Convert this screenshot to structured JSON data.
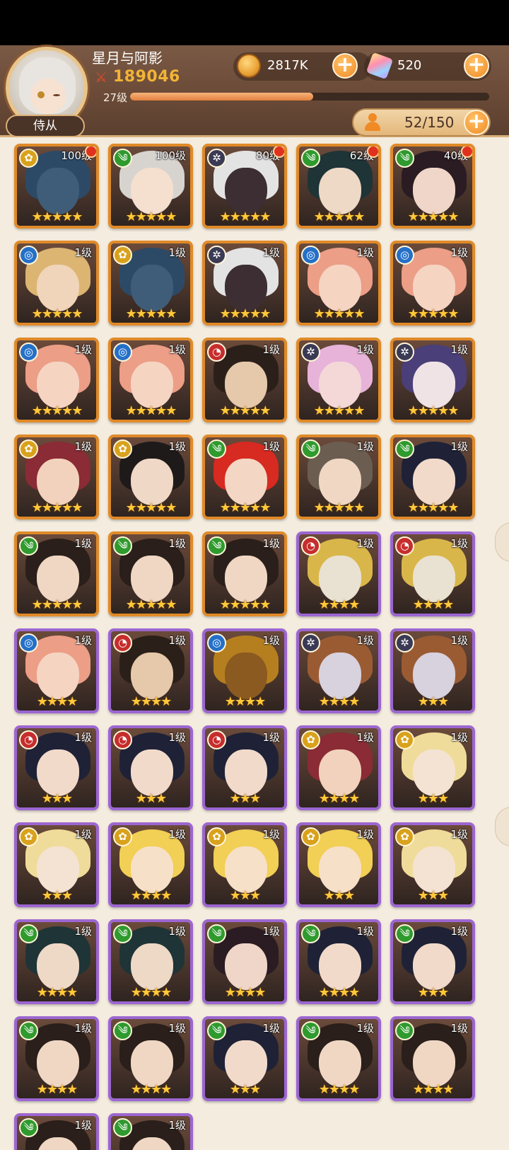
{
  "player": {
    "name": "星月与阿影",
    "power": "189046",
    "level": "27级",
    "xp_fraction": 0.51
  },
  "resources": {
    "coins": "2817K",
    "gems": "520"
  },
  "tab_label": "侍从",
  "roster_count": "52/150",
  "colors": {
    "gold_border": "#e08a28",
    "purple_border": "#9c66d1",
    "element_gold": "#d9a21c",
    "element_green": "#2f9a2e",
    "element_blue": "#2470c8",
    "element_red": "#c62d2d",
    "element_dark": "#3a3a55"
  },
  "heroes": [
    {
      "level": "100级",
      "element": "gold",
      "stars": "★★★★★",
      "frame": "gold",
      "alert": true,
      "hair": "#2c4a66",
      "skin": "#3f5d78"
    },
    {
      "level": "100级",
      "element": "green",
      "stars": "★★★★★",
      "frame": "gold",
      "alert": false,
      "hair": "#d7d4cf",
      "skin": "#f5dfcf"
    },
    {
      "level": "80级",
      "element": "dark",
      "stars": "★★★★★",
      "frame": "gold",
      "alert": true,
      "hair": "#e3e3e3",
      "skin": "#3c2e33"
    },
    {
      "level": "62级",
      "element": "green",
      "stars": "★★★★★",
      "frame": "gold",
      "alert": true,
      "hair": "#1f3437",
      "skin": "#eed8c6"
    },
    {
      "level": "40级",
      "element": "green",
      "stars": "★★★★★",
      "frame": "gold",
      "alert": true,
      "hair": "#2a1c22",
      "skin": "#f0d6c8"
    },
    {
      "level": "1级",
      "element": "blue",
      "stars": "★★★★★",
      "frame": "gold",
      "alert": false,
      "hair": "#dcb572",
      "skin": "#f0d5ba"
    },
    {
      "level": "1级",
      "element": "gold",
      "stars": "★★★★★",
      "frame": "gold",
      "alert": false,
      "hair": "#2c4a66",
      "skin": "#3f5d78"
    },
    {
      "level": "1级",
      "element": "dark",
      "stars": "★★★★★",
      "frame": "gold",
      "alert": false,
      "hair": "#e3e3e3",
      "skin": "#3c2e33"
    },
    {
      "level": "1级",
      "element": "blue",
      "stars": "★★★★★",
      "frame": "gold",
      "alert": false,
      "hair": "#ec9e86",
      "skin": "#f5d4c2"
    },
    {
      "level": "1级",
      "element": "blue",
      "stars": "★★★★★",
      "frame": "gold",
      "alert": false,
      "hair": "#ec9e86",
      "skin": "#f5d4c2"
    },
    {
      "level": "1级",
      "element": "blue",
      "stars": "★★★★★",
      "frame": "gold",
      "alert": false,
      "hair": "#ec9e86",
      "skin": "#f5d4c2"
    },
    {
      "level": "1级",
      "element": "blue",
      "stars": "★★★★★",
      "frame": "gold",
      "alert": false,
      "hair": "#ec9e86",
      "skin": "#f5d4c2"
    },
    {
      "level": "1级",
      "element": "red",
      "stars": "★★★★★",
      "frame": "gold",
      "alert": false,
      "hair": "#2b2019",
      "skin": "#e6c8aa"
    },
    {
      "level": "1级",
      "element": "dark",
      "stars": "★★★★★",
      "frame": "gold",
      "alert": false,
      "hair": "#e7b3d9",
      "skin": "#f4d8d8"
    },
    {
      "level": "1级",
      "element": "dark",
      "stars": "★★★★★",
      "frame": "gold",
      "alert": false,
      "hair": "#4a3f78",
      "skin": "#f0e3e6"
    },
    {
      "level": "1级",
      "element": "gold",
      "stars": "★★★★★",
      "frame": "gold",
      "alert": false,
      "hair": "#8a2b35",
      "skin": "#f2d2bc"
    },
    {
      "level": "1级",
      "element": "gold",
      "stars": "★★★★★",
      "frame": "gold",
      "alert": false,
      "hair": "#1f1a1a",
      "skin": "#f0d8c6"
    },
    {
      "level": "1级",
      "element": "green",
      "stars": "★★★★★",
      "frame": "gold",
      "alert": false,
      "hair": "#d72a21",
      "skin": "#f4d6c4"
    },
    {
      "level": "1级",
      "element": "green",
      "stars": "★★★★★",
      "frame": "gold",
      "alert": false,
      "hair": "#6b5d50",
      "skin": "#efd7c4"
    },
    {
      "level": "1级",
      "element": "green",
      "stars": "★★★★★",
      "frame": "gold",
      "alert": false,
      "hair": "#1f2236",
      "skin": "#f2dacb"
    },
    {
      "level": "1级",
      "element": "green",
      "stars": "★★★★★",
      "frame": "gold",
      "alert": false,
      "hair": "#2a1f1a",
      "skin": "#efd7c4"
    },
    {
      "level": "1级",
      "element": "green",
      "stars": "★★★★★",
      "frame": "gold",
      "alert": false,
      "hair": "#2a1f1a",
      "skin": "#efd7c4"
    },
    {
      "level": "1级",
      "element": "green",
      "stars": "★★★★★",
      "frame": "gold",
      "alert": false,
      "hair": "#2a1f1a",
      "skin": "#efd7c4"
    },
    {
      "level": "1级",
      "element": "red",
      "stars": "★★★★",
      "frame": "purple",
      "alert": false,
      "hair": "#d9b64a",
      "skin": "#e9e2d2"
    },
    {
      "level": "1级",
      "element": "red",
      "stars": "★★★★",
      "frame": "purple",
      "alert": false,
      "hair": "#d9b64a",
      "skin": "#e9e2d2"
    },
    {
      "level": "1级",
      "element": "blue",
      "stars": "★★★★",
      "frame": "purple",
      "alert": false,
      "hair": "#ec9e86",
      "skin": "#f5d4c2"
    },
    {
      "level": "1级",
      "element": "red",
      "stars": "★★★★",
      "frame": "purple",
      "alert": false,
      "hair": "#2b2019",
      "skin": "#e6c8aa"
    },
    {
      "level": "1级",
      "element": "blue",
      "stars": "★★★★",
      "frame": "purple",
      "alert": false,
      "hair": "#b57f1f",
      "skin": "#8a5a20"
    },
    {
      "level": "1级",
      "element": "dark",
      "stars": "★★★★",
      "frame": "purple",
      "alert": false,
      "hair": "#9a5b33",
      "skin": "#d8d1de"
    },
    {
      "level": "1级",
      "element": "dark",
      "stars": "★★★",
      "frame": "purple",
      "alert": false,
      "hair": "#9a5b33",
      "skin": "#d8d1de"
    },
    {
      "level": "1级",
      "element": "red",
      "stars": "★★★",
      "frame": "purple",
      "alert": false,
      "hair": "#1f2236",
      "skin": "#f2dacb"
    },
    {
      "level": "1级",
      "element": "red",
      "stars": "★★★",
      "frame": "purple",
      "alert": false,
      "hair": "#1f2236",
      "skin": "#f2dacb"
    },
    {
      "level": "1级",
      "element": "red",
      "stars": "★★★",
      "frame": "purple",
      "alert": false,
      "hair": "#1f2236",
      "skin": "#f2dacb"
    },
    {
      "level": "1级",
      "element": "gold",
      "stars": "★★★★",
      "frame": "purple",
      "alert": false,
      "hair": "#8a2b35",
      "skin": "#f2d2bc"
    },
    {
      "level": "1级",
      "element": "gold",
      "stars": "★★★",
      "frame": "purple",
      "alert": false,
      "hair": "#f0dc9a",
      "skin": "#f4e3d2"
    },
    {
      "level": "1级",
      "element": "gold",
      "stars": "★★★",
      "frame": "purple",
      "alert": false,
      "hair": "#f0dc9a",
      "skin": "#f4e3d2"
    },
    {
      "level": "1级",
      "element": "gold",
      "stars": "★★★★",
      "frame": "purple",
      "alert": false,
      "hair": "#f2cf55",
      "skin": "#f7e0c8"
    },
    {
      "level": "1级",
      "element": "gold",
      "stars": "★★★",
      "frame": "purple",
      "alert": false,
      "hair": "#f2cf55",
      "skin": "#f7e0c8"
    },
    {
      "level": "1级",
      "element": "gold",
      "stars": "★★★",
      "frame": "purple",
      "alert": false,
      "hair": "#f2cf55",
      "skin": "#f7e0c8"
    },
    {
      "level": "1级",
      "element": "gold",
      "stars": "★★★",
      "frame": "purple",
      "alert": false,
      "hair": "#f0dc9a",
      "skin": "#f4e3d2"
    },
    {
      "level": "1级",
      "element": "green",
      "stars": "★★★★",
      "frame": "purple",
      "alert": false,
      "hair": "#1f3437",
      "skin": "#eed8c6"
    },
    {
      "level": "1级",
      "element": "green",
      "stars": "★★★★",
      "frame": "purple",
      "alert": false,
      "hair": "#1f3437",
      "skin": "#eed8c6"
    },
    {
      "level": "1级",
      "element": "green",
      "stars": "★★★★",
      "frame": "purple",
      "alert": false,
      "hair": "#2a1c22",
      "skin": "#f0d6c8"
    },
    {
      "level": "1级",
      "element": "green",
      "stars": "★★★★",
      "frame": "purple",
      "alert": false,
      "hair": "#1f2236",
      "skin": "#f2dacb"
    },
    {
      "level": "1级",
      "element": "green",
      "stars": "★★★",
      "frame": "purple",
      "alert": false,
      "hair": "#1f2236",
      "skin": "#f2dacb"
    },
    {
      "level": "1级",
      "element": "green",
      "stars": "★★★★",
      "frame": "purple",
      "alert": false,
      "hair": "#2a1f1a",
      "skin": "#efd7c4"
    },
    {
      "level": "1级",
      "element": "green",
      "stars": "★★★★",
      "frame": "purple",
      "alert": false,
      "hair": "#2a1f1a",
      "skin": "#efd7c4"
    },
    {
      "level": "1级",
      "element": "green",
      "stars": "★★★",
      "frame": "purple",
      "alert": false,
      "hair": "#1f2236",
      "skin": "#f2dacb"
    },
    {
      "level": "1级",
      "element": "green",
      "stars": "★★★★",
      "frame": "purple",
      "alert": false,
      "hair": "#2a1f1a",
      "skin": "#efd7c4"
    },
    {
      "level": "1级",
      "element": "green",
      "stars": "★★★★",
      "frame": "purple",
      "alert": false,
      "hair": "#2a1f1a",
      "skin": "#efd7c4"
    },
    {
      "level": "1级",
      "element": "green",
      "stars": "★★★★",
      "frame": "purple",
      "alert": false,
      "hair": "#2a1f1a",
      "skin": "#efd7c4"
    },
    {
      "level": "1级",
      "element": "green",
      "stars": "★★★★",
      "frame": "purple",
      "alert": false,
      "hair": "#2a1f1a",
      "skin": "#efd7c4"
    }
  ]
}
